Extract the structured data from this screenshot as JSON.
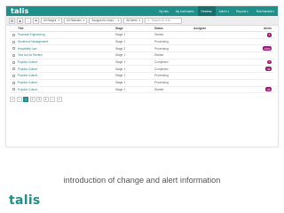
{
  "app": {
    "logo": "talis"
  },
  "nav": {
    "items": [
      "My lists",
      "My bookmarks",
      "Reviews",
      "Admin ▾",
      "Reports ▾"
    ],
    "active_index": 2,
    "user": "Rob Karobdi ▾"
  },
  "toolbar": {
    "filters": [
      {
        "label": "All Stages",
        "icon": "caret-down-icon"
      },
      {
        "label": "All Statuses",
        "icon": "caret-down-icon"
      },
      {
        "label": "Assigned to Anyo...",
        "icon": "caret-down-icon"
      },
      {
        "label": "All Alerts",
        "icon": "caret-down-icon"
      }
    ],
    "search_placeholder": "Search for a lis..."
  },
  "table": {
    "headers": {
      "title": "Title",
      "stage": "Stage",
      "status": "Status",
      "assignee": "Assignee",
      "alerts": "Alerts"
    },
    "rows": [
      {
        "title": "Financial Engineering",
        "stage": "Stage 1",
        "status": "Started",
        "assignee": "",
        "alerts": "2"
      },
      {
        "title": "Workforce Management",
        "stage": "Stage 1",
        "status": "Processing",
        "assignee": "",
        "alerts": ""
      },
      {
        "title": "Hospitality Law",
        "stage": "Stage 3",
        "status": "Processing",
        "assignee": "",
        "alerts": "1000"
      },
      {
        "title": "Test List for Review",
        "stage": "Stage 1",
        "status": "Started",
        "assignee": "",
        "alerts": ""
      },
      {
        "title": "Popular Culture",
        "stage": "Stage 1",
        "status": "Completed",
        "assignee": "",
        "alerts": "7"
      },
      {
        "title": "Popular Culture",
        "stage": "Stage 1",
        "status": "Completed",
        "assignee": "",
        "alerts": "36"
      },
      {
        "title": "Popular Culture",
        "stage": "Stage 1",
        "status": "Processing",
        "assignee": "",
        "alerts": ""
      },
      {
        "title": "Popular Culture",
        "stage": "Stage 1",
        "status": "Processing",
        "assignee": "",
        "alerts": ""
      },
      {
        "title": "Popular Culture",
        "stage": "Stage 1",
        "status": "Started",
        "assignee": "",
        "alerts": "26"
      }
    ]
  },
  "pagination": {
    "first": "«",
    "prev": "‹",
    "pages": [
      "1",
      "2",
      "3",
      "4"
    ],
    "active_page": "1",
    "next": "›",
    "last": "»"
  },
  "caption": "introduction of change and alert information",
  "brand": "talis",
  "colors": {
    "primary": "#1f8f8a",
    "primary_dark": "#15706c",
    "badge": "#9b1e7b"
  }
}
